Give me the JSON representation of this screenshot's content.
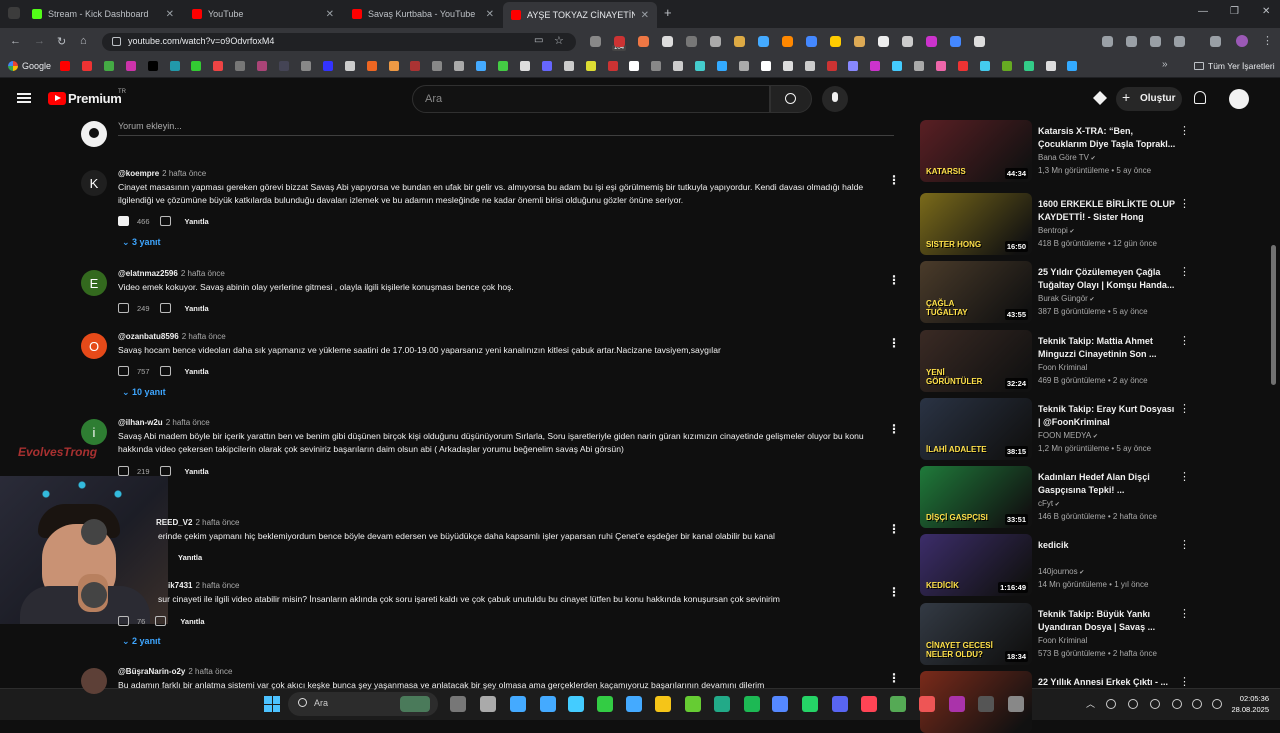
{
  "browser": {
    "tabs": [
      {
        "title": "Stream - Kick Dashboard",
        "fav": "#53fc18"
      },
      {
        "title": "YouTube",
        "fav": "#ff0000"
      },
      {
        "title": "Savaş Kurtbaba - YouTube",
        "fav": "#ff0000"
      },
      {
        "title": "AYŞE TOKYAZ CİNAYETİNİN Bİ...",
        "fav": "#ff0000"
      }
    ],
    "url": "youtube.com/watch?v=o9OdvrfoxM4",
    "bookmarks": {
      "google": "Google",
      "all": "Tüm Yer İşaretleri"
    },
    "ext_badge": "104"
  },
  "youtube": {
    "logo": "Premium",
    "logo_sup": "TR",
    "search_placeholder": "Ara",
    "create": "Oluştur"
  },
  "comments": {
    "add_placeholder": "Yorum ekleyin...",
    "reply_label": "Yanıtla",
    "items": [
      {
        "author": "@koempre",
        "time": "2 hafta önce",
        "avatar": "K",
        "avatar_color": "#1f1f1f",
        "text": "Cinayet masasının yapması gereken görevi bizzat Savaş Abi yapıyorsa ve bundan en ufak bir gelir vs. almıyorsa bu adam bu işi eşi görülmemiş bir tutkuyla yapıyordur. Kendi davası olmadığı halde ilgilendiği ve çözümüne büyük katkılarda bulunduğu davaları izlemek ve bu adamın mesleğinde ne kadar önemli birisi olduğunu gözler önüne seriyor.",
        "likes": "466",
        "liked": true,
        "replies": "3 yanıt"
      },
      {
        "author": "@elatnmaz2596",
        "time": "2 hafta önce",
        "avatar": "E",
        "avatar_color": "#33691e",
        "text": "Video emek kokuyor. Savaş abinin olay yerlerine gitmesi , olayla ilgili kişilerle konuşması bence çok hoş.",
        "likes": "249",
        "liked": false,
        "replies": ""
      },
      {
        "author": "@ozanbatu8596",
        "time": "2 hafta önce",
        "avatar": "O",
        "avatar_color": "#e64a19",
        "text": "Savaş hocam bence videoları daha sık yapmanız ve yükleme saatini de 17.00-19.00 yaparsanız yeni kanalınızın kitlesi çabuk artar.Nacizane tavsiyem,saygılar",
        "likes": "757",
        "liked": false,
        "replies": "10 yanıt"
      },
      {
        "author": "@ilhan-w2u",
        "time": "2 hafta önce",
        "avatar": "i",
        "avatar_color": "#2e7d32",
        "text": "Savaş Abi madem böyle bir içerik yarattın ben ve benim gibi düşünen birçok kişi olduğunu düşünüyorum Sırlarla, Soru işaretleriyle giden narin güran kızımızın cinayetinde gelişmeler oluyor bu konu hakkında video çekersen takipcilerin olarak çok seviniriz başarıların daim olsun abi ( Arkadaşlar yorumu beğenelim savaş Abi görsün)",
        "likes": "219",
        "liked": false,
        "replies": ""
      },
      {
        "author": "REED_V2",
        "time": "2 hafta önce",
        "avatar": "",
        "avatar_color": "#444",
        "text": "erinde çekim yapmanı hiç beklemiyordum bence böyle devam edersen ve büyüdükçe daha kapsamlı işler yaparsan ruhi Çenet'e eşdeğer bir kanal olabilir bu kanal",
        "likes": "",
        "liked": false,
        "replies": ""
      },
      {
        "author": "ik7431",
        "time": "2 hafta önce",
        "avatar": "",
        "avatar_color": "#444",
        "text": "sur cinayeti ile ilgili video atabilir misin? İnsanların aklında çok soru işareti kaldı ve çok çabuk unutuldu bu cinayet lütfen bu konu hakkında konuşursan çok sevinirim",
        "likes": "76",
        "liked": false,
        "replies": "2 yanıt"
      },
      {
        "author": "@BüşraNarin-o2y",
        "time": "2 hafta önce",
        "avatar": "",
        "avatar_color": "#5d4037",
        "text": "Bu adamın farklı bir anlatma sistemi var çok akıcı keşke bunca şey yaşanmasa ve anlatacak bir şey olmasa ama gerçeklerden kaçamıyoruz başarılarının devamını dilerim",
        "likes": "",
        "liked": false,
        "replies": ""
      }
    ]
  },
  "sidebar": {
    "videos": [
      {
        "title": "Katarsis X-TRA: “Ben, Çocuklarım Diye Taşla Toprakl...",
        "channel": "Bana Göre TV",
        "verified": true,
        "views": "1,3 Mn görüntüleme",
        "age": "5 ay önce",
        "duration": "44:34",
        "thumb": "#5a1f24",
        "thumb_text": "KATARSIS"
      },
      {
        "title": "1600 ERKEKLE BİRLİKTE OLUP KAYDETTİ! - Sister Hong",
        "channel": "Bentropi",
        "verified": true,
        "views": "418 B görüntüleme",
        "age": "12 gün önce",
        "duration": "16:50",
        "thumb": "#7a6a1a",
        "thumb_text": "SISTER HONG"
      },
      {
        "title": "25 Yıldır Çözülemeyen Çağla Tuğaltay Olayı | Komşu Handa...",
        "channel": "Burak Güngör",
        "verified": true,
        "views": "387 B görüntüleme",
        "age": "5 ay önce",
        "duration": "43:55",
        "thumb": "#4a3b2a",
        "thumb_text": "ÇAĞLA TUĞALTAY"
      },
      {
        "title": "Teknik Takip: Mattia Ahmet Minguzzi Cinayetinin Son ...",
        "channel": "Foon Kriminal",
        "verified": false,
        "views": "469 B görüntüleme",
        "age": "2 ay önce",
        "duration": "32:24",
        "thumb": "#3a2a24",
        "thumb_text": "YENİ GÖRÜNTÜLER"
      },
      {
        "title": "Teknik Takip: Eray Kurt Dosyası | @FoonKriminal",
        "channel": "FOON MEDYA",
        "verified": true,
        "views": "1,2 Mn görüntüleme",
        "age": "5 ay önce",
        "duration": "38:15",
        "thumb": "#2a3344",
        "thumb_text": "İLAHİ ADALETE"
      },
      {
        "title": "Kadınları Hedef Alan Dişçi Gaspçısına Tepki! ...",
        "channel": "cFyt",
        "verified": true,
        "views": "146 B görüntüleme",
        "age": "2 hafta önce",
        "duration": "33:51",
        "thumb": "#1f7a3a",
        "thumb_text": "DİŞÇİ GASPÇISI"
      },
      {
        "title": "kedicik",
        "channel": "140journos",
        "verified": true,
        "views": "14 Mn görüntüleme",
        "age": "1 yıl önce",
        "duration": "1:16:49",
        "thumb": "#3c2d6a",
        "thumb_text": "KEDİCİK"
      },
      {
        "title": "Teknik Takip: Büyük Yankı Uyandıran Dosya | Savaş ...",
        "channel": "Foon Kriminal",
        "verified": false,
        "views": "573 B görüntüleme",
        "age": "2 hafta önce",
        "duration": "18:34",
        "thumb": "#333a44",
        "thumb_text": "CİNAYET GECESİ NELER OLDU?"
      },
      {
        "title": "22 Yıllık Annesi Erkek Çıktı - ...",
        "channel": "",
        "verified": false,
        "views": "",
        "age": "",
        "duration": "",
        "thumb": "#7a2a1a",
        "thumb_text": ""
      }
    ]
  },
  "taskbar": {
    "search": "Ara",
    "time": "02:05:36",
    "date": "28.08.2025"
  },
  "overlay": {
    "watermark": "EvolvesTrong"
  }
}
